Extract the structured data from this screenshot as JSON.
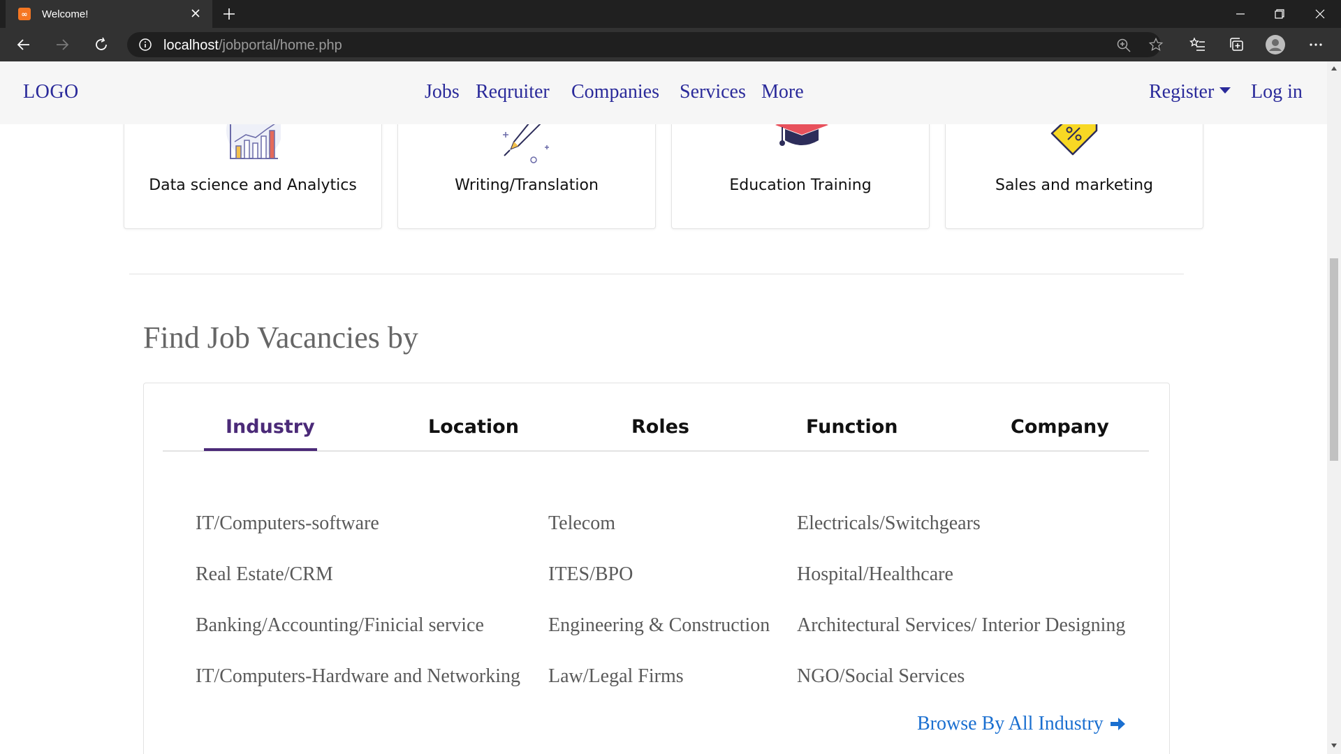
{
  "browser": {
    "tab_title": "Welcome!",
    "favicon_text": "∞",
    "url_host": "localhost",
    "url_path": "/jobportal/home.php"
  },
  "navbar": {
    "logo": "LOGO",
    "items": [
      "Jobs",
      "Reqruiter",
      "Companies",
      "Services",
      "More"
    ],
    "register": "Register",
    "login": "Log in"
  },
  "categories": [
    {
      "label": "Data science and Analytics",
      "icon": "analytics-chart-icon"
    },
    {
      "label": "Writing/Translation",
      "icon": "pen-writing-icon"
    },
    {
      "label": "Education Training",
      "icon": "graduation-cap-icon"
    },
    {
      "label": "Sales and marketing",
      "icon": "discount-tag-icon"
    }
  ],
  "vacancies": {
    "title": "Find Job Vacancies by",
    "tabs": [
      "Industry",
      "Location",
      "Roles",
      "Function",
      "Company"
    ],
    "active_tab": "Industry",
    "industries": [
      [
        "IT/Computers-software",
        "Telecom",
        "Electricals/Switchgears"
      ],
      [
        "Real Estate/CRM",
        "ITES/BPO",
        "Hospital/Healthcare"
      ],
      [
        "Banking/Accounting/Finicial service",
        "Engineering & Construction",
        "Architectural Services/ Interior Designing"
      ],
      [
        "IT/Computers-Hardware and Networking",
        "Law/Legal Firms",
        "NGO/Social Services"
      ]
    ],
    "browse_all": "Browse By All Industry"
  },
  "colors": {
    "nav_text": "#2a2a9a",
    "active_tab": "#4b2a78",
    "link": "#1a6fd0"
  }
}
